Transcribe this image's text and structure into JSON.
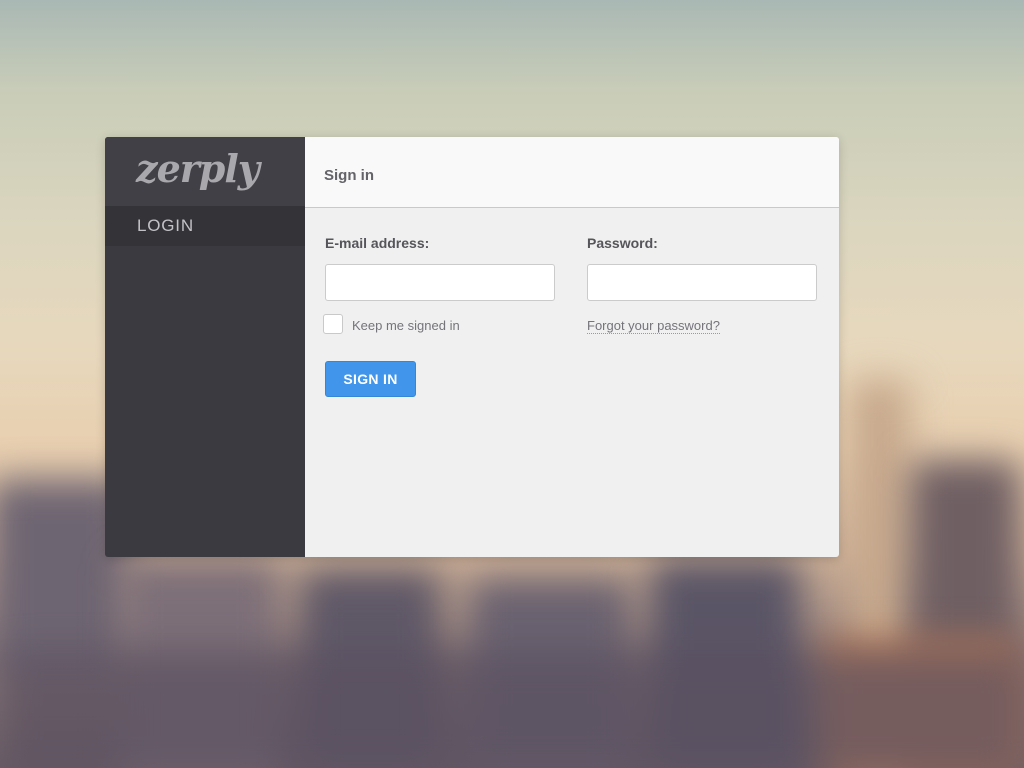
{
  "sidebar": {
    "logo_text": "zerply",
    "nav_items": [
      {
        "label": "LOGIN"
      }
    ]
  },
  "main": {
    "title": "Sign in",
    "email": {
      "label": "E-mail address:",
      "value": "",
      "placeholder": ""
    },
    "password": {
      "label": "Password:",
      "value": "",
      "placeholder": ""
    },
    "keep_signed_in": {
      "label": "Keep me signed in",
      "checked": false
    },
    "forgot_password_label": "Forgot your password?",
    "sign_in_button_label": "SIGN IN"
  },
  "colors": {
    "sidebar_bg": "#3b3a40",
    "main_bg": "#f0f0f0",
    "accent_button": "#4195ea"
  }
}
